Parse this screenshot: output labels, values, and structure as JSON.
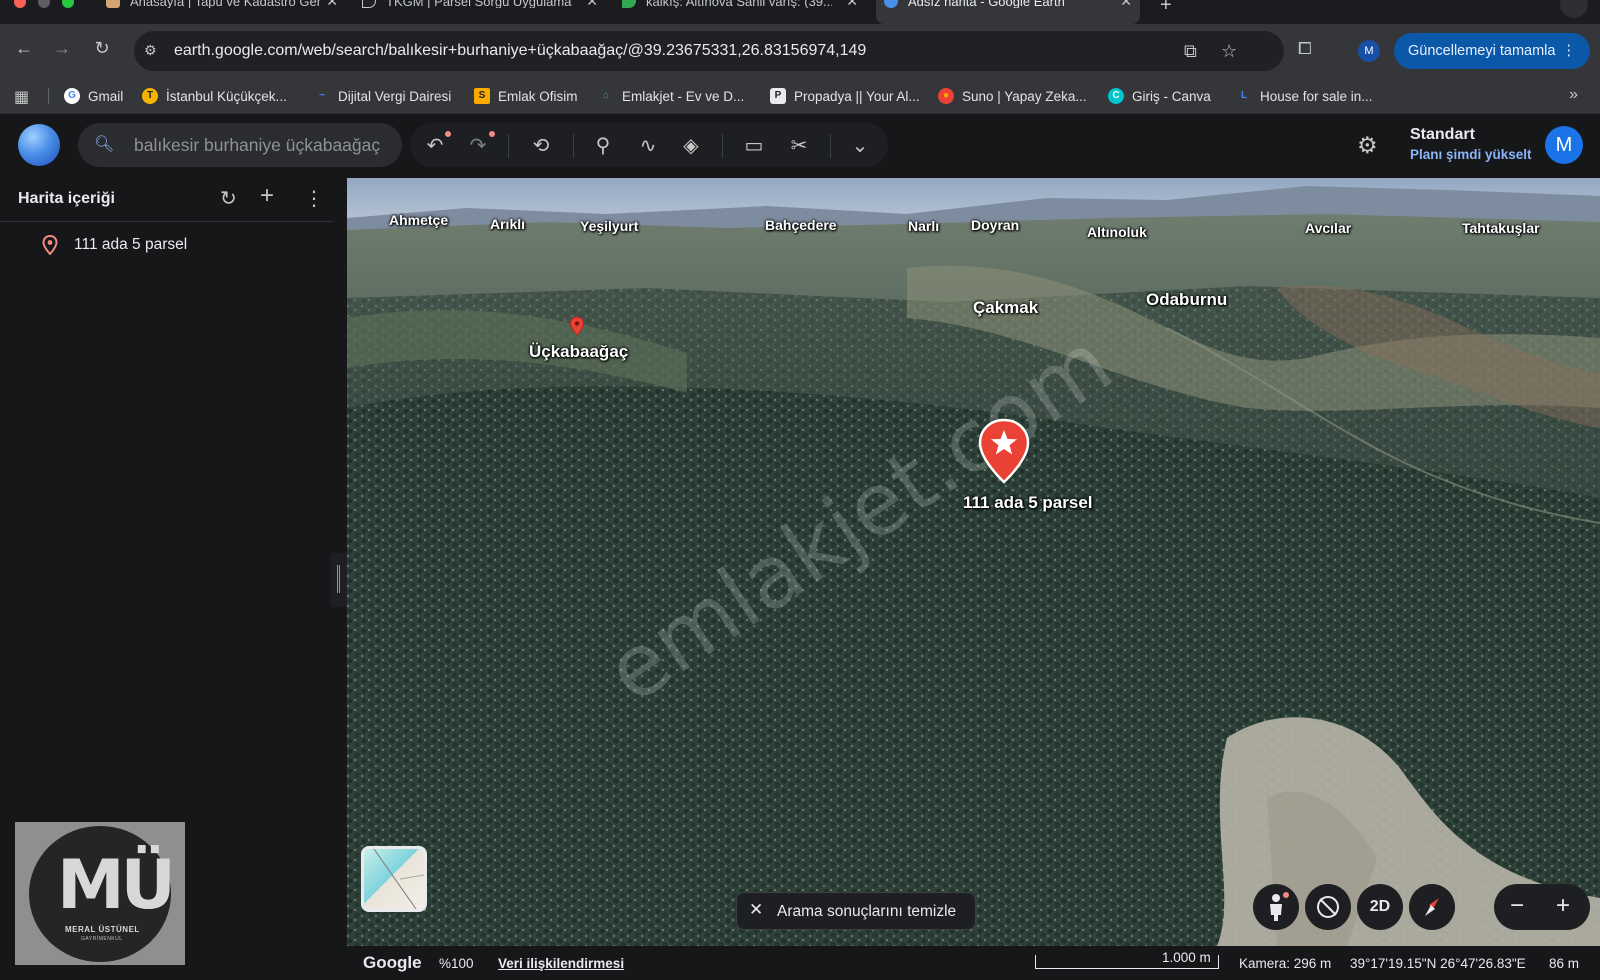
{
  "browser": {
    "tabs": [
      {
        "title": "Anasayfa | Tapu ve Kadastro Genel Müdürlüğü",
        "favicon_color": "#d4a373"
      },
      {
        "title": "TKGM | Parsel Sorgu Uygulaması",
        "favicon_color": "#202124"
      },
      {
        "title": "kalkış: Altınova Sahil varış: (39...",
        "favicon_color": "#34a853"
      },
      {
        "title": "Adsız harita - Google Earth",
        "favicon_color": "#4a8fe8"
      }
    ],
    "new_tab_label": "+",
    "url": "earth.google.com/web/search/balıkesir+burhaniye+üçkabaağaç/@39.23675331,26.83156974,149",
    "profile_initial": "M",
    "update_button": "Güncellemeyi tamamla",
    "bookmarks": [
      {
        "label": "Gmail",
        "icon": "G",
        "color": "#ffffff"
      },
      {
        "label": "İstanbul Küçükçek...",
        "icon": "T",
        "color": "#f4b400"
      },
      {
        "label": "Dijital Vergi Dairesi",
        "icon": "~",
        "color": "#4285f4"
      },
      {
        "label": "Emlak Ofisim",
        "icon": "S",
        "color": "#f9ab00"
      },
      {
        "label": "Emlakjet - Ev ve D...",
        "icon": "⌂",
        "color": "#34a853"
      },
      {
        "label": "Propadya || Your Al...",
        "icon": "P",
        "color": "#e8eaed"
      },
      {
        "label": "Suno | Yapay Zeka...",
        "icon": "●",
        "color": "#ea4335"
      },
      {
        "label": "Giriş - Canva",
        "icon": "C",
        "color": "#00c4cc"
      },
      {
        "label": "House for sale in...",
        "icon": "L",
        "color": "#4285f4"
      }
    ]
  },
  "earth": {
    "search_value": "balıkesir burhaniye üçkabaağaç",
    "plan_title": "Standart",
    "plan_link": "Planı şimdi yükselt",
    "avatar_initial": "M",
    "sidebar": {
      "title": "Harita içeriği",
      "items": [
        {
          "label": "111 ada 5 parsel"
        }
      ]
    },
    "map": {
      "place_labels": [
        "Ahmetçe",
        "Arıklı",
        "Yeşilyurt",
        "Bahçedere",
        "Narlı",
        "Doyran",
        "Altınoluk",
        "Avcılar",
        "Tahtakuşlar",
        "Çakmak",
        "Odaburnu",
        "Üçkabaağaç"
      ],
      "placemark_label": "111 ada 5 parsel",
      "watermark": "emlakjet.com",
      "clear_results": "Arama sonuçlarını temizle",
      "btn_2d": "2D"
    },
    "status": {
      "brand": "Google",
      "zoom": "%100",
      "data_link": "Veri ilişkilendirmesi",
      "scale_label": "1.000 m",
      "camera": "Kamera: 296 m",
      "coords": "39°17'19.15\"N 26°47'26.83\"E",
      "elevation": "86 m"
    }
  },
  "watermark_logo": {
    "letters": "MÜ",
    "name": "MERAL ÜSTÜNEL",
    "sub": "GAYRİMENKUL"
  },
  "colors": {
    "accent": "#8ab4f8",
    "update_button": "#0b57a8",
    "pin": "#ea4335"
  }
}
